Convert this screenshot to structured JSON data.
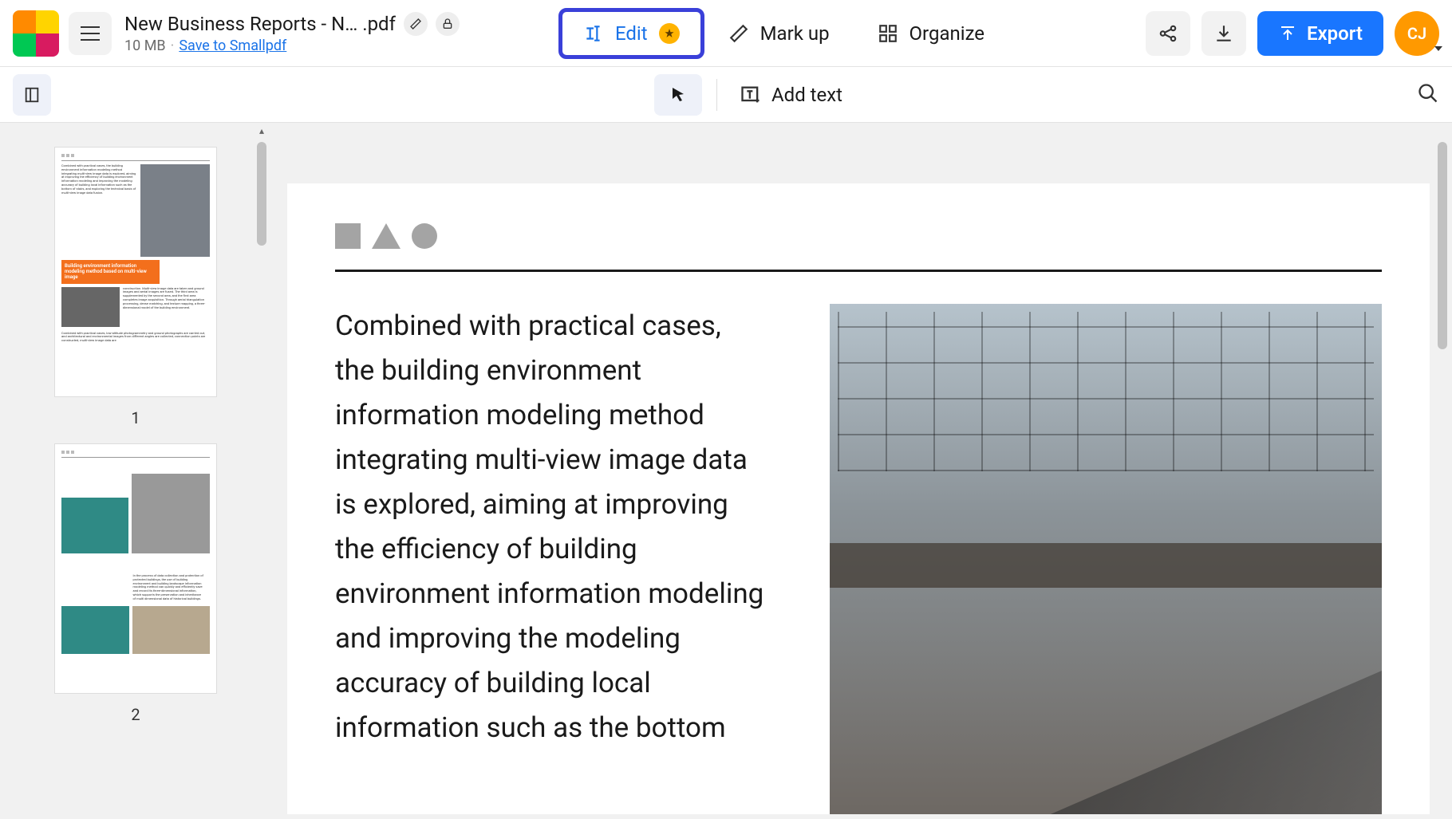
{
  "file": {
    "title": "New Business Reports - N… .pdf",
    "size": "10 MB",
    "save_link": "Save to Smallpdf"
  },
  "modes": {
    "edit": "Edit",
    "markup": "Mark up",
    "organize": "Organize"
  },
  "actions": {
    "export": "Export"
  },
  "avatar": "CJ",
  "subtoolbar": {
    "add_text": "Add text"
  },
  "thumbnails": {
    "page1_num": "1",
    "page2_num": "2",
    "p1_orange_title": "Building environment information modeling method based on multi-view image"
  },
  "document": {
    "body_text": "Combined with practical cases, the building environment information modeling method integrating multi-view image data is explored, aiming at improving the efficiency of building environment information modeling and improving the modeling accuracy of building local information such as the bottom"
  }
}
